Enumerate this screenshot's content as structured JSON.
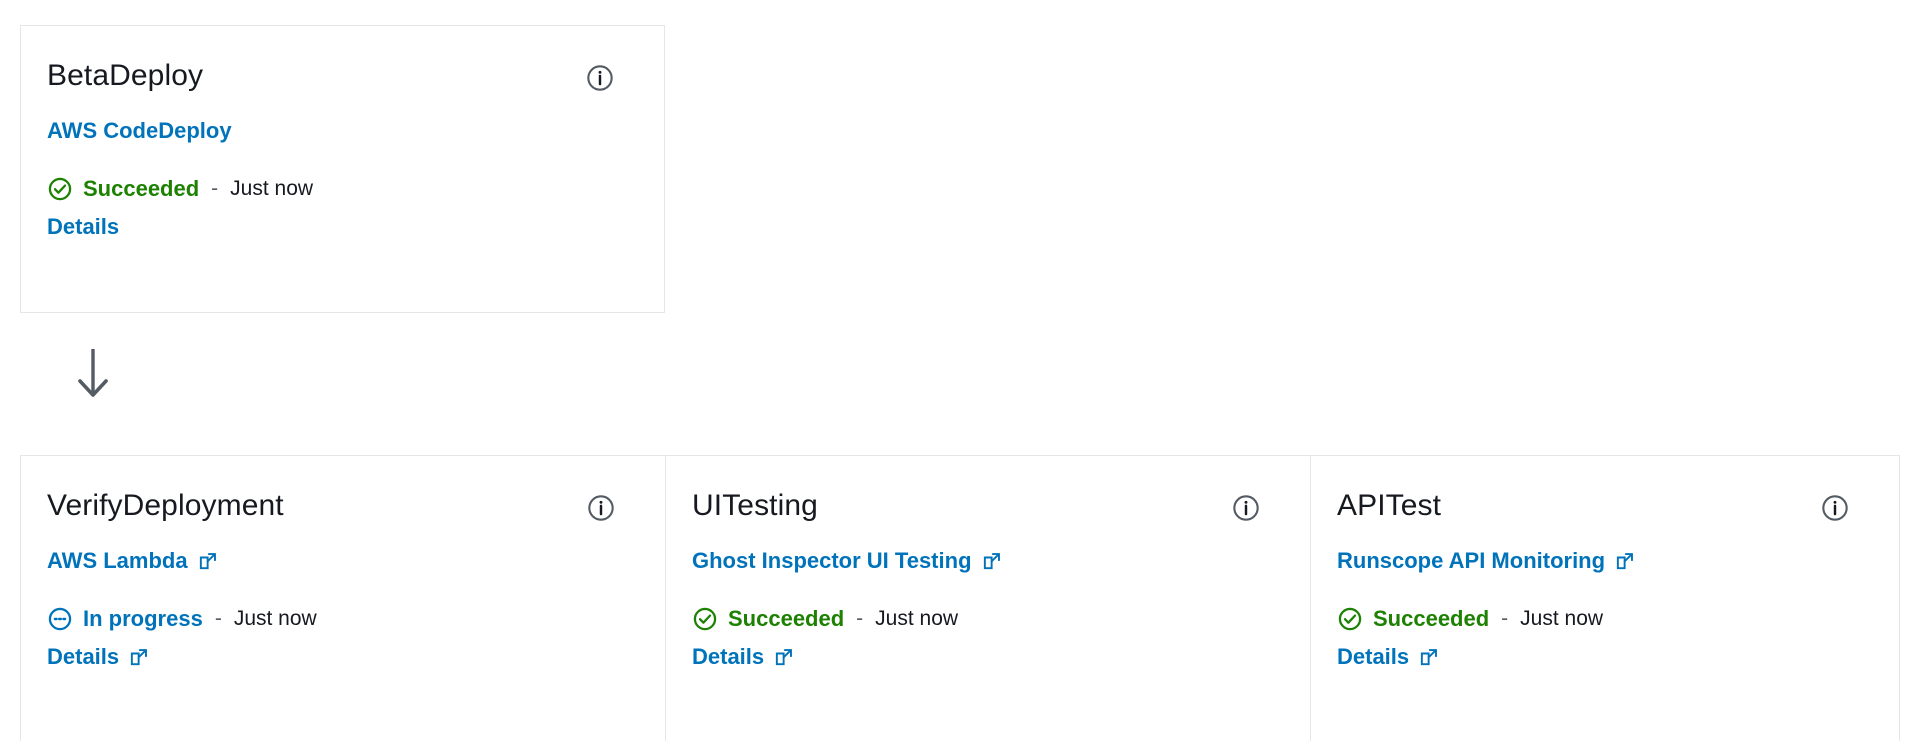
{
  "pipeline": {
    "flow_arrow_icon": "arrow-down-icon",
    "stages": [
      {
        "row_id": "deploy-row",
        "actions": [
          {
            "title": "BetaDeploy",
            "info_icon": "info-circle-icon",
            "provider": "AWS CodeDeploy",
            "provider_external": false,
            "status": "Succeeded",
            "status_kind": "success",
            "status_icon": "check-circle-icon",
            "separator": "-",
            "time": "Just now",
            "details_label": "Details",
            "details_external": false
          }
        ]
      },
      {
        "row_id": "test-row",
        "actions": [
          {
            "title": "VerifyDeployment",
            "info_icon": "info-circle-icon",
            "provider": "AWS Lambda",
            "provider_external": true,
            "status": "In progress",
            "status_kind": "inprogress",
            "status_icon": "in-progress-circle-icon",
            "separator": "-",
            "time": "Just now",
            "details_label": "Details",
            "details_external": true
          },
          {
            "title": "UITesting",
            "info_icon": "info-circle-icon",
            "provider": "Ghost Inspector UI Testing",
            "provider_external": true,
            "status": "Succeeded",
            "status_kind": "success",
            "status_icon": "check-circle-icon",
            "separator": "-",
            "time": "Just now",
            "details_label": "Details",
            "details_external": true
          },
          {
            "title": "APITest",
            "info_icon": "info-circle-icon",
            "provider": "Runscope API Monitoring",
            "provider_external": true,
            "status": "Succeeded",
            "status_kind": "success",
            "status_icon": "check-circle-icon",
            "separator": "-",
            "time": "Just now",
            "details_label": "Details",
            "details_external": true
          }
        ]
      }
    ]
  },
  "colors": {
    "link": "#0073bb",
    "success": "#1d8102",
    "in_progress": "#0073bb",
    "title": "#16191f",
    "border": "#e4e6e7",
    "icon_gray": "#545b64"
  }
}
